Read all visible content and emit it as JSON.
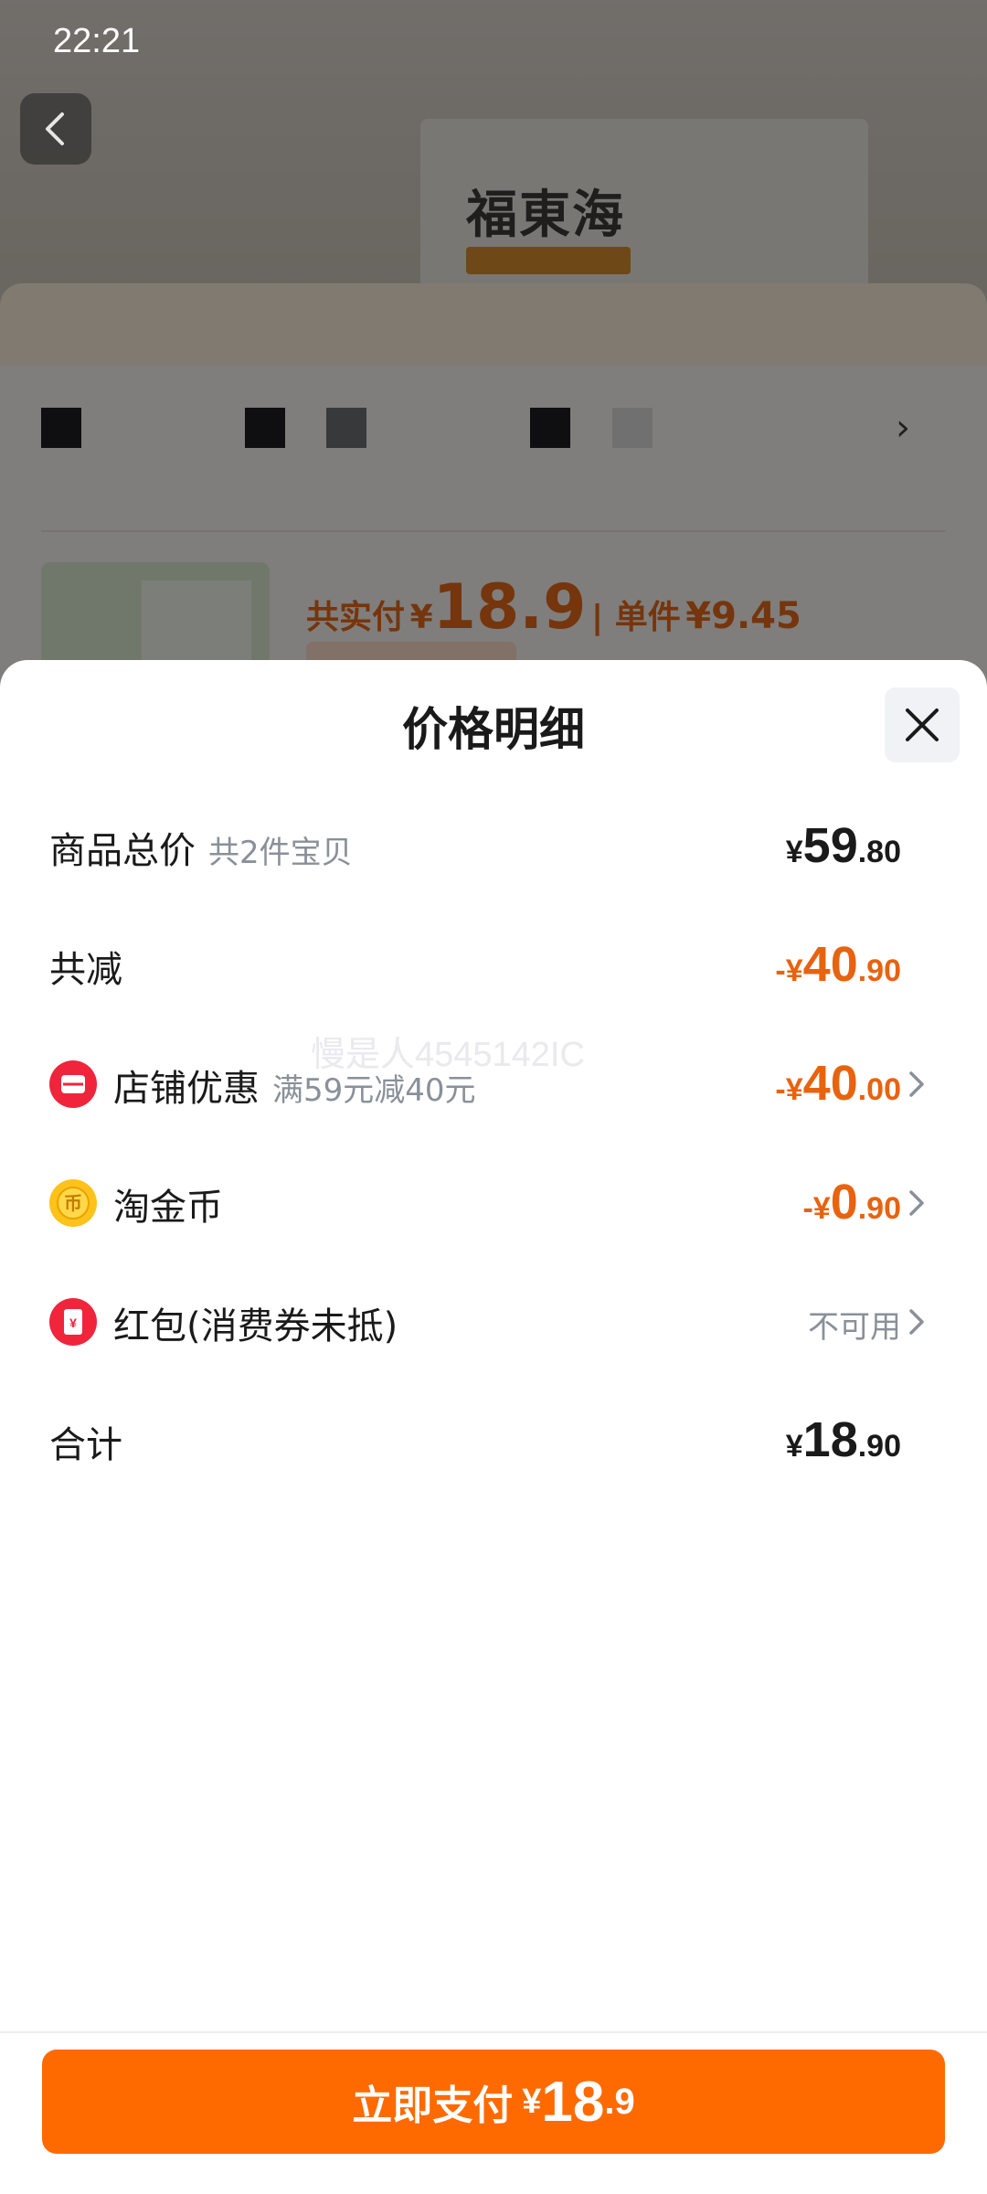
{
  "status_bar": {
    "time": "22:21"
  },
  "background": {
    "box_brand": "福東海",
    "price_prefix": "共实付",
    "price_currency": "¥",
    "price_value": "18.9",
    "unit_label": "单件",
    "unit_price": "¥9.45"
  },
  "sheet": {
    "title": "价格明细",
    "rows": {
      "total": {
        "label": "商品总价",
        "sub": "共2件宝贝",
        "sign": "",
        "currency": "¥",
        "int": "59",
        "dec": ".80"
      },
      "discount": {
        "label": "共减",
        "sign": "-",
        "currency": "¥",
        "int": "40",
        "dec": ".90"
      },
      "shop": {
        "label": "店铺优惠",
        "sub": "满59元减40元",
        "sign": "-",
        "currency": "¥",
        "int": "40",
        "dec": ".00",
        "icon": "shop-coupon-icon"
      },
      "coins": {
        "label": "淘金币",
        "sign": "-",
        "currency": "¥",
        "int": "0",
        "dec": ".90",
        "icon": "gold-coin-icon"
      },
      "redpacket": {
        "label": "红包(消费券未抵)",
        "status": "不可用",
        "icon": "red-packet-icon"
      },
      "sum": {
        "label": "合计",
        "currency": "¥",
        "int": "18",
        "dec": ".90"
      }
    },
    "watermark": "慢是人4545142IC"
  },
  "footer": {
    "pay_label": "立即支付",
    "currency": "¥",
    "int": "18",
    "dec": ".9"
  },
  "colors": {
    "accent": "#ff6a00",
    "discount": "#e8630f",
    "text": "#1a1a1a",
    "muted": "#8a9099"
  }
}
